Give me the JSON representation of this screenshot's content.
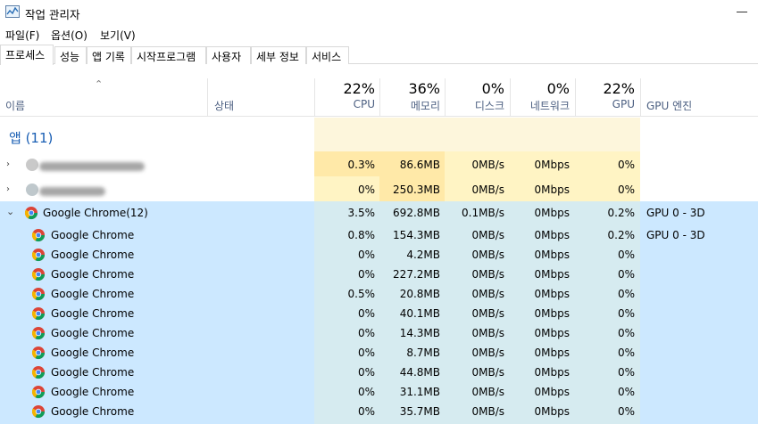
{
  "window": {
    "title": "작업 관리자"
  },
  "menu": [
    "파일(F)",
    "옵션(O)",
    "보기(V)"
  ],
  "tabs": [
    "프로세스",
    "성능",
    "앱 기록",
    "시작프로그램",
    "사용자",
    "세부 정보",
    "서비스"
  ],
  "columns": {
    "name": "이름",
    "status": "상태",
    "cpu": {
      "pct": "22%",
      "label": "CPU"
    },
    "memory": {
      "pct": "36%",
      "label": "메모리"
    },
    "disk": {
      "pct": "0%",
      "label": "디스크"
    },
    "network": {
      "pct": "0%",
      "label": "네트워크"
    },
    "gpu": {
      "pct": "22%",
      "label": "GPU"
    },
    "gpu_engine": "GPU 엔진"
  },
  "group": {
    "label": "앱 (11)"
  },
  "apps": [
    {
      "name": "",
      "cpu": "0.3%",
      "memory": "86.6MB",
      "disk": "0MB/s",
      "network": "0Mbps",
      "gpu": "0%",
      "gpu_engine": ""
    },
    {
      "name": "",
      "cpu": "0%",
      "memory": "250.3MB",
      "disk": "0MB/s",
      "network": "0Mbps",
      "gpu": "0%",
      "gpu_engine": ""
    }
  ],
  "chrome_group": {
    "name": "Google Chrome(12)",
    "cpu": "3.5%",
    "memory": "692.8MB",
    "disk": "0.1MB/s",
    "network": "0Mbps",
    "gpu": "0.2%",
    "gpu_engine": "GPU 0 - 3D"
  },
  "chrome_children": [
    {
      "name": "Google Chrome",
      "cpu": "0.8%",
      "memory": "154.3MB",
      "disk": "0MB/s",
      "network": "0Mbps",
      "gpu": "0.2%",
      "gpu_engine": "GPU 0 - 3D"
    },
    {
      "name": "Google Chrome",
      "cpu": "0%",
      "memory": "4.2MB",
      "disk": "0MB/s",
      "network": "0Mbps",
      "gpu": "0%",
      "gpu_engine": ""
    },
    {
      "name": "Google Chrome",
      "cpu": "0%",
      "memory": "227.2MB",
      "disk": "0MB/s",
      "network": "0Mbps",
      "gpu": "0%",
      "gpu_engine": ""
    },
    {
      "name": "Google Chrome",
      "cpu": "0.5%",
      "memory": "20.8MB",
      "disk": "0MB/s",
      "network": "0Mbps",
      "gpu": "0%",
      "gpu_engine": ""
    },
    {
      "name": "Google Chrome",
      "cpu": "0%",
      "memory": "40.1MB",
      "disk": "0MB/s",
      "network": "0Mbps",
      "gpu": "0%",
      "gpu_engine": ""
    },
    {
      "name": "Google Chrome",
      "cpu": "0%",
      "memory": "14.3MB",
      "disk": "0MB/s",
      "network": "0Mbps",
      "gpu": "0%",
      "gpu_engine": ""
    },
    {
      "name": "Google Chrome",
      "cpu": "0%",
      "memory": "8.7MB",
      "disk": "0MB/s",
      "network": "0Mbps",
      "gpu": "0%",
      "gpu_engine": ""
    },
    {
      "name": "Google Chrome",
      "cpu": "0%",
      "memory": "44.8MB",
      "disk": "0MB/s",
      "network": "0Mbps",
      "gpu": "0%",
      "gpu_engine": ""
    },
    {
      "name": "Google Chrome",
      "cpu": "0%",
      "memory": "31.1MB",
      "disk": "0MB/s",
      "network": "0Mbps",
      "gpu": "0%",
      "gpu_engine": ""
    },
    {
      "name": "Google Chrome",
      "cpu": "0%",
      "memory": "35.7MB",
      "disk": "0MB/s",
      "network": "0Mbps",
      "gpu": "0%",
      "gpu_engine": ""
    }
  ],
  "colors": {
    "heat_light": "#fff4c4",
    "heat_medium": "#ffe9a8",
    "heat_pale": "#fdf6dc",
    "selected": "#cce8ff",
    "group_text": "#1a5fb4"
  }
}
